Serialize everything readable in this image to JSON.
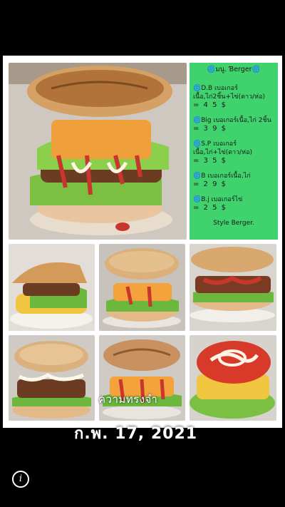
{
  "menu": {
    "title": "🌀มนู. Ɓerger🌀",
    "items": [
      {
        "name": "🌀D.B เบอเกอร์เนื้อ,ไก่2ชิ้น+ไข่(ดาว/ห่อ)",
        "price": "= 4 5 $"
      },
      {
        "name": "🌀Big เบอเกอร์เนื้อ,ไก่ 2ชิ้น",
        "price": "= 3 9 $"
      },
      {
        "name": "🌀S.P เบอเกอร์เนื้อ,ไก่+ไข่(ดาว/ห่อ)",
        "price": "= 3 5 $"
      },
      {
        "name": "🌀B เบอเกอร์เนื้อ,ไก่",
        "price": "= 2 9 $"
      },
      {
        "name": "🌀B.j เบอเกอร์ไข่",
        "price": "= 2 5 $"
      }
    ],
    "style_label": "Style Berger."
  },
  "overlay": {
    "memory_label": "ความทรงจำ",
    "date": "ก.พ. 17, 2021"
  },
  "controls": {
    "info_icon_glyph": "i"
  },
  "colors": {
    "menu_background": "#3fd26d",
    "page_background": "#000000"
  }
}
